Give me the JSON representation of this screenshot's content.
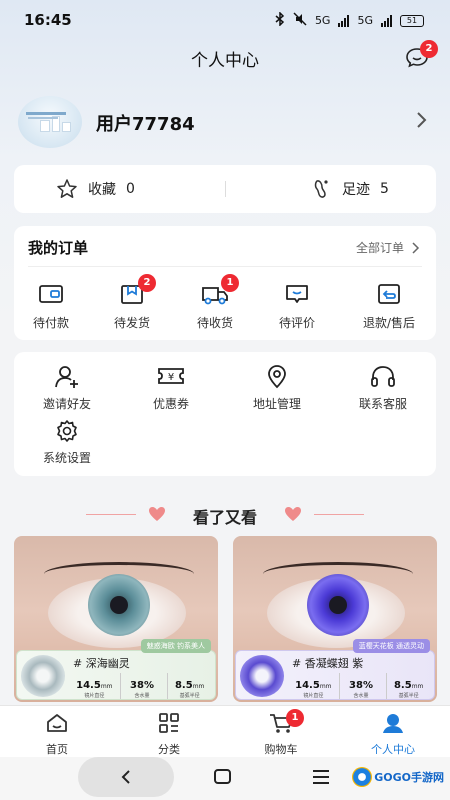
{
  "status": {
    "time": "16:45",
    "net1": "5G",
    "net2": "5G",
    "battery": "51"
  },
  "header": {
    "title": "个人中心",
    "message_badge": "2"
  },
  "profile": {
    "username": "用户77784"
  },
  "favorites": {
    "fav_label": "收藏",
    "fav_count": "0",
    "trace_label": "足迹",
    "trace_count": "5"
  },
  "orders": {
    "title": "我的订单",
    "all_label": "全部订单",
    "items": [
      {
        "label": "待付款",
        "icon": "wallet-icon"
      },
      {
        "label": "待发货",
        "icon": "package-icon",
        "badge": "2"
      },
      {
        "label": "待收货",
        "icon": "truck-icon",
        "badge": "1"
      },
      {
        "label": "待评价",
        "icon": "comment-icon"
      },
      {
        "label": "退款/售后",
        "icon": "return-icon"
      }
    ]
  },
  "services": {
    "items": [
      {
        "label": "邀请好友",
        "icon": "add-user-icon"
      },
      {
        "label": "优惠券",
        "icon": "coupon-icon"
      },
      {
        "label": "地址管理",
        "icon": "location-icon"
      },
      {
        "label": "联系客服",
        "icon": "headset-icon"
      },
      {
        "label": "系统设置",
        "icon": "gear-icon"
      }
    ]
  },
  "recommend": {
    "title": "看了又看",
    "products": [
      {
        "name": "# 深海幽灵",
        "tag": "魅惑海欧 钓系美人",
        "diameter": "14.5",
        "diameter_unit": "mm",
        "diameter_label": "镜片直径",
        "water": "38%",
        "water_label": "含水量",
        "base": "8.5",
        "base_unit": "mm",
        "base_label": "基弧半径",
        "accent": "#9fc9a0",
        "iris_color": "#5c8e99"
      },
      {
        "name": "# 香凝蝶翅 紫",
        "tag": "蓝樱天花板 通透灵动",
        "diameter": "14.5",
        "diameter_unit": "mm",
        "diameter_label": "镜片直径",
        "water": "38%",
        "water_label": "含水量",
        "base": "8.5",
        "base_unit": "mm",
        "base_label": "基弧半径",
        "accent": "#9b8ee6",
        "iris_color": "#4b3ad6"
      }
    ]
  },
  "tabbar": {
    "tabs": [
      {
        "label": "首页",
        "icon": "home-icon"
      },
      {
        "label": "分类",
        "icon": "category-icon"
      },
      {
        "label": "购物车",
        "icon": "cart-icon",
        "badge": "1"
      },
      {
        "label": "个人中心",
        "icon": "profile-icon",
        "active": true
      }
    ]
  },
  "watermark": {
    "text": "GOGO手游网"
  },
  "colors": {
    "accent": "#1e7bd8",
    "badge": "#ee2a32"
  }
}
